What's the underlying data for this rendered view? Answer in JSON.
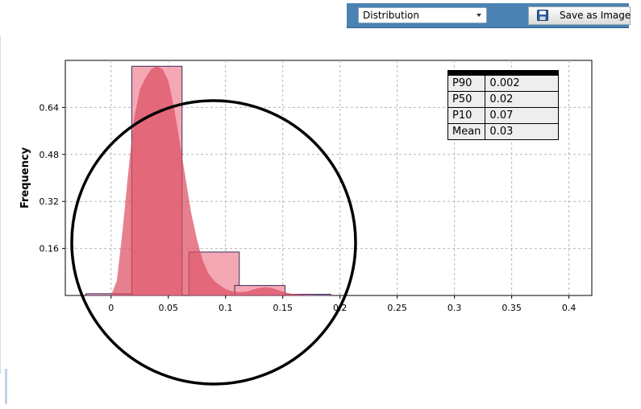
{
  "toolbar": {
    "dropdown_value": "Distribution",
    "save_label": "Save as Image"
  },
  "stats_table": [
    {
      "label": "P90",
      "value": "0.002"
    },
    {
      "label": "P50",
      "value": "0.02"
    },
    {
      "label": "P10",
      "value": "0.07"
    },
    {
      "label": "Mean",
      "value": "0.03"
    }
  ],
  "chart_data": {
    "type": "bar",
    "ylabel": "Frequency",
    "xlabel": "",
    "title": "",
    "xlim": [
      -0.04,
      0.42
    ],
    "ylim": [
      0,
      0.8
    ],
    "x_ticks": [
      0,
      0.05,
      0.1,
      0.15,
      0.2,
      0.25,
      0.3,
      0.35,
      0.4
    ],
    "x_tick_labels": [
      "0",
      "0.05",
      "0.1",
      "0.15",
      "0.2",
      "0.25",
      "0.3",
      "0.35",
      "0.4"
    ],
    "y_ticks": [
      0.16,
      0.32,
      0.48,
      0.64
    ],
    "y_tick_labels": [
      "0.16",
      "0.32",
      "0.48",
      "0.64"
    ],
    "grid": true,
    "bins": [
      {
        "x0": -0.022,
        "x1": 0.018,
        "value": 0.006
      },
      {
        "x0": 0.018,
        "x1": 0.062,
        "value": 0.78
      },
      {
        "x0": 0.068,
        "x1": 0.112,
        "value": 0.148
      },
      {
        "x0": 0.108,
        "x1": 0.152,
        "value": 0.034
      },
      {
        "x0": 0.152,
        "x1": 0.192,
        "value": 0.004
      }
    ],
    "density_curve": [
      [
        0.0,
        0.0
      ],
      [
        0.005,
        0.05
      ],
      [
        0.01,
        0.22
      ],
      [
        0.015,
        0.42
      ],
      [
        0.02,
        0.6
      ],
      [
        0.025,
        0.7
      ],
      [
        0.03,
        0.74
      ],
      [
        0.035,
        0.77
      ],
      [
        0.04,
        0.78
      ],
      [
        0.045,
        0.77
      ],
      [
        0.05,
        0.73
      ],
      [
        0.055,
        0.64
      ],
      [
        0.06,
        0.52
      ],
      [
        0.065,
        0.4
      ],
      [
        0.07,
        0.28
      ],
      [
        0.075,
        0.19
      ],
      [
        0.08,
        0.12
      ],
      [
        0.085,
        0.075
      ],
      [
        0.09,
        0.05
      ],
      [
        0.095,
        0.035
      ],
      [
        0.1,
        0.022
      ],
      [
        0.105,
        0.015
      ],
      [
        0.11,
        0.012
      ],
      [
        0.115,
        0.012
      ],
      [
        0.12,
        0.015
      ],
      [
        0.125,
        0.021
      ],
      [
        0.13,
        0.026
      ],
      [
        0.135,
        0.028
      ],
      [
        0.14,
        0.026
      ],
      [
        0.145,
        0.02
      ],
      [
        0.15,
        0.013
      ],
      [
        0.155,
        0.008
      ],
      [
        0.16,
        0.005
      ],
      [
        0.17,
        0.002
      ],
      [
        0.18,
        0.0
      ]
    ],
    "colors": {
      "bar_fill": "#f4a8b4",
      "bar_stroke": "#3a2d5c",
      "density_fill": "#dc4f62"
    }
  }
}
